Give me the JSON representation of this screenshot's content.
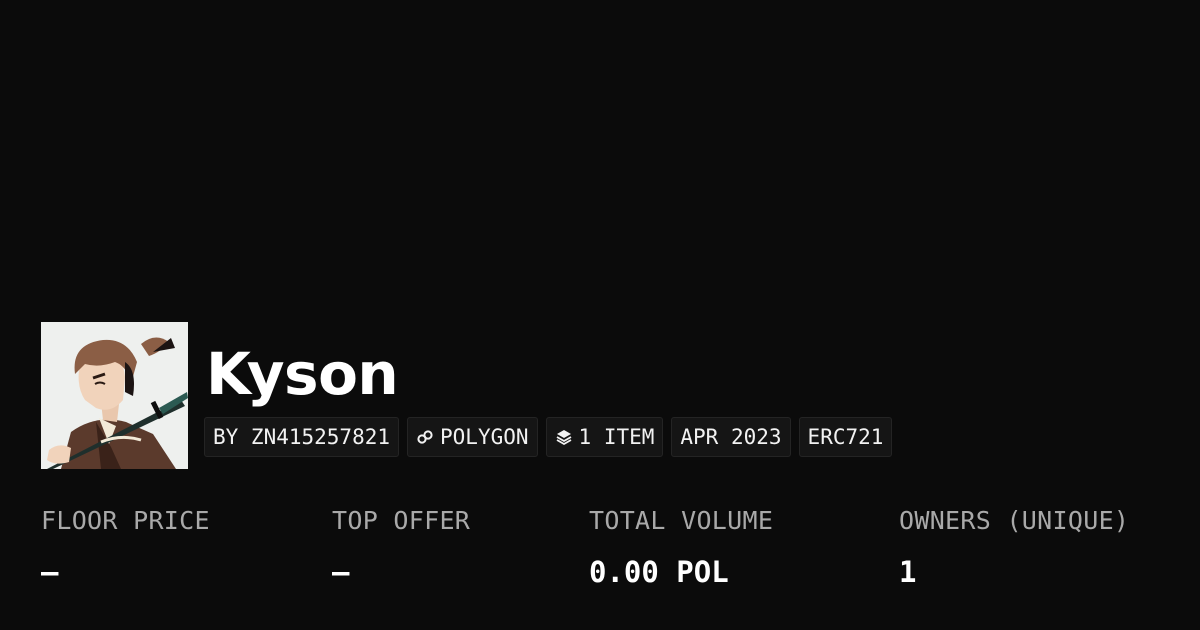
{
  "collection": {
    "name": "Kyson",
    "avatar_alt": "collection-avatar",
    "tags": [
      {
        "label": "BY ZN415257821",
        "icon": null
      },
      {
        "label": "POLYGON",
        "icon": "chain-link-icon"
      },
      {
        "label": "1 ITEM",
        "icon": "layers-icon"
      },
      {
        "label": "APR 2023",
        "icon": null
      },
      {
        "label": "ERC721",
        "icon": null
      }
    ]
  },
  "stats": [
    {
      "label": "FLOOR PRICE",
      "value": "–"
    },
    {
      "label": "TOP OFFER",
      "value": "–"
    },
    {
      "label": "TOTAL VOLUME",
      "value": "0.00 POL"
    },
    {
      "label": "OWNERS (UNIQUE)",
      "value": "1"
    }
  ],
  "colors": {
    "background": "#0b0b0b",
    "tag_background": "#151515",
    "label_gray": "#a9a9a9"
  }
}
